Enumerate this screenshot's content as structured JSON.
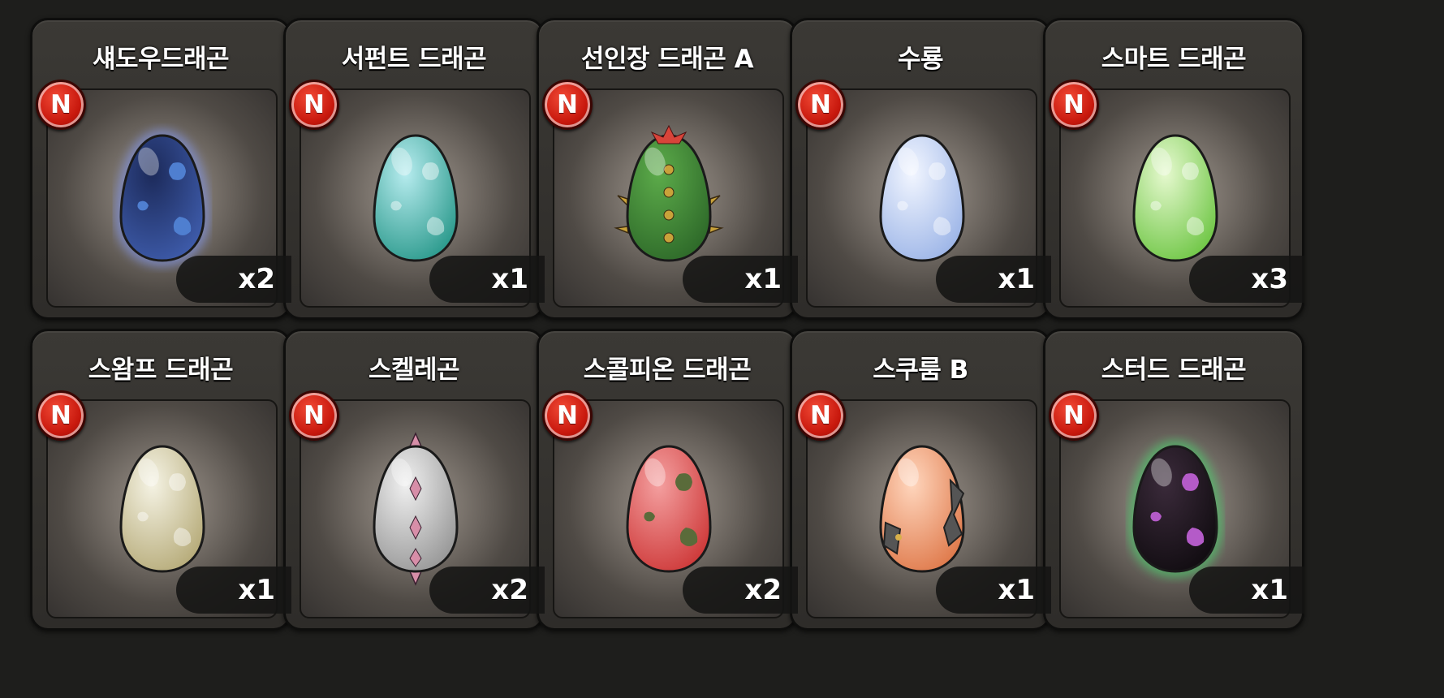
{
  "badge_label": "N",
  "items": [
    {
      "name": "섀도우드래곤",
      "qty": "x2",
      "icon": "shadow-dragon-egg-icon",
      "colors": [
        "#1c2a5a",
        "#3d5aa8"
      ],
      "aura": "#7f8fd6"
    },
    {
      "name": "서펀트 드래곤",
      "qty": "x1",
      "icon": "serpent-dragon-egg-icon",
      "colors": [
        "#b7ecef",
        "#2f9c8f"
      ],
      "aura": null
    },
    {
      "name": "선인장 드래곤 A",
      "qty": "x1",
      "icon": "cactus-dragon-egg-icon",
      "colors": [
        "#5cab4a",
        "#2f6b2a"
      ],
      "aura": null
    },
    {
      "name": "수룡",
      "qty": "x1",
      "icon": "water-dragon-egg-icon",
      "colors": [
        "#f2f6ff",
        "#9fb7e8"
      ],
      "aura": null
    },
    {
      "name": "스마트 드래곤",
      "qty": "x3",
      "icon": "smart-dragon-egg-icon",
      "colors": [
        "#e6f9cf",
        "#73c84a"
      ],
      "aura": null
    },
    {
      "name": "스왐프 드래곤",
      "qty": "x1",
      "icon": "swamp-dragon-egg-icon",
      "colors": [
        "#f5f3e4",
        "#b8ad7c"
      ],
      "aura": null
    },
    {
      "name": "스켈레곤",
      "qty": "x2",
      "icon": "skelegon-egg-icon",
      "colors": [
        "#f0f0f0",
        "#9a9a9a"
      ],
      "aura": null
    },
    {
      "name": "스콜피온 드래곤",
      "qty": "x2",
      "icon": "scorpion-dragon-egg-icon",
      "colors": [
        "#f4a0a0",
        "#cf3c3c"
      ],
      "aura": null
    },
    {
      "name": "스쿠룸 B",
      "qty": "x1",
      "icon": "scroom-b-egg-icon",
      "colors": [
        "#ffd6bd",
        "#e07c4e"
      ],
      "aura": null
    },
    {
      "name": "스터드 드래곤",
      "qty": "x1",
      "icon": "stud-dragon-egg-icon",
      "colors": [
        "#3a2a3a",
        "#120d12"
      ],
      "aura": "#4fc06a"
    }
  ]
}
